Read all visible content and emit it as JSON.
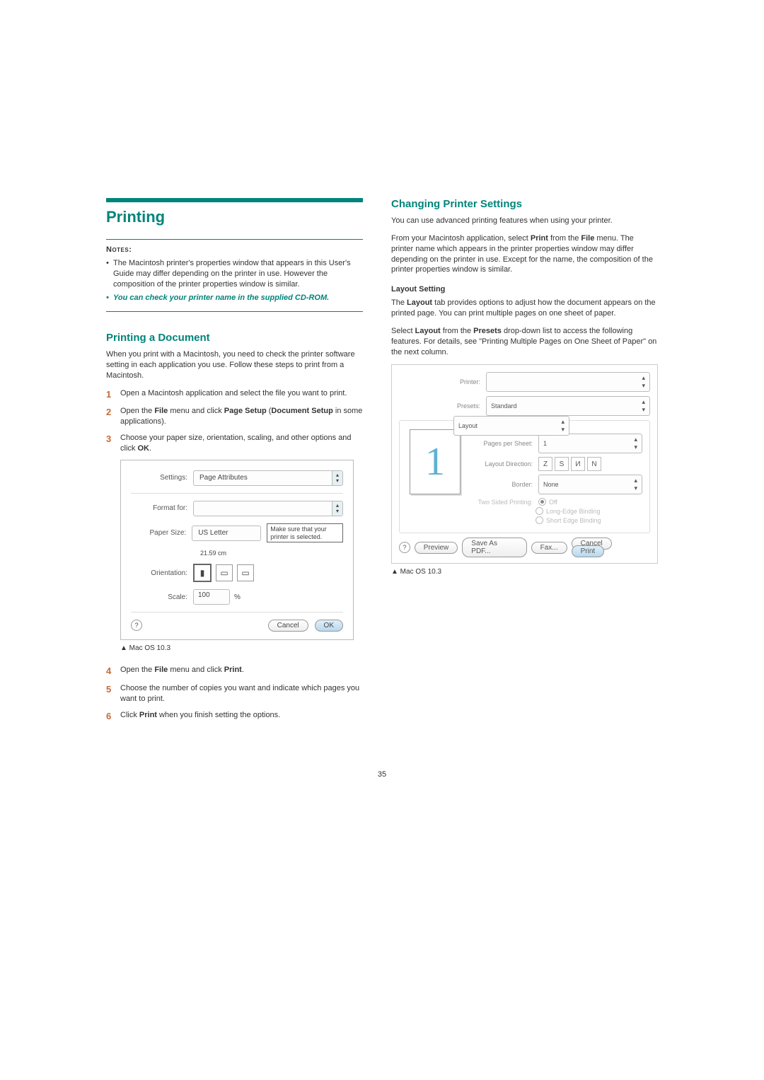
{
  "left": {
    "title": "Printing",
    "notes_label": "Notes",
    "note1": "The Macintosh printer's properties window that appears in this User's Guide may differ depending on the printer in use. However the composition of the printer properties window is similar.",
    "note2": "You can check your printer name in the supplied CD-ROM.",
    "section1_title": "Printing a Document",
    "section1_para": "When you print with a Macintosh, you need to check the printer software setting in each application you use. Follow these steps to print from a Macintosh.",
    "step1": "Open a Macintosh application and select the file you want to print.",
    "step2_a": "Open the ",
    "step2_b": "File",
    "step2_c": " menu and click ",
    "step2_d": "Page Setup",
    "step2_e": " (",
    "step2_f": "Document Setup",
    "step2_g": " in some applications).",
    "step3_a": "Choose your paper size, orientation, scaling, and other options and click ",
    "step3_b": "OK",
    "step3_c": ".",
    "fig1": {
      "settings_label": "Settings:",
      "settings_value": "Page Attributes",
      "format_label": "Format for:",
      "paper_label": "Paper Size:",
      "paper_value": "US Letter",
      "paper_dim": "21.59 cm",
      "orient_label": "Orientation:",
      "scale_label": "Scale:",
      "scale_value": "100",
      "scale_pct": "%",
      "cancel": "Cancel",
      "ok": "OK",
      "callout": "Make sure that your printer is selected.",
      "caption": "▲ Mac OS 10.3"
    },
    "step4_a": "Open the ",
    "step4_b": "File",
    "step4_c": " menu and click ",
    "step4_d": "Print",
    "step4_e": ".",
    "step5": "Choose the number of copies you want and indicate which pages you want to print.",
    "step6_a": "Click ",
    "step6_b": "Print",
    "step6_c": " when you finish setting the options."
  },
  "right": {
    "section_title": "Changing Printer Settings",
    "para1": "You can use advanced printing features when using your printer.",
    "para2_a": "From your Macintosh application, select ",
    "para2_b": "Print",
    "para2_c": " from the ",
    "para2_d": "File",
    "para2_e": " menu. The printer name which appears in the printer properties window may differ depending on the printer in use. Except for the name, the composition of the printer properties window is similar.",
    "layout_setting_title": "Layout Setting",
    "layout_para1_a": "The ",
    "layout_para1_b": "Layout",
    "layout_para1_c": " tab provides options to adjust how the document appears on the printed page. You can print multiple pages on one sheet of paper.",
    "layout_para2_a": "Select ",
    "layout_para2_b": "Layout",
    "layout_para2_c": " from the ",
    "layout_para2_d": "Presets",
    "layout_para2_e": " drop-down list to access the following features. For details, see \"Printing Multiple Pages on One Sheet of Paper\" on the next column.",
    "fig2": {
      "printer_label": "Printer:",
      "presets_label": "Presets:",
      "presets_value": "Standard",
      "layout_value": "Layout",
      "pps_label": "Pages per Sheet:",
      "pps_value": "1",
      "dir_label": "Layout Direction:",
      "border_label": "Border:",
      "border_value": "None",
      "tsp_label": "Two Sided Printing:",
      "tsp_off": "Off",
      "tsp_long": "Long-Edge Binding",
      "tsp_short": "Short Edge Binding",
      "preview_digit": "1",
      "preview_btn": "Preview",
      "save_btn": "Save As PDF...",
      "fax_btn": "Fax...",
      "cancel": "Cancel",
      "print": "Print",
      "caption": "▲ Mac OS 10.3"
    }
  },
  "page_num": "35"
}
